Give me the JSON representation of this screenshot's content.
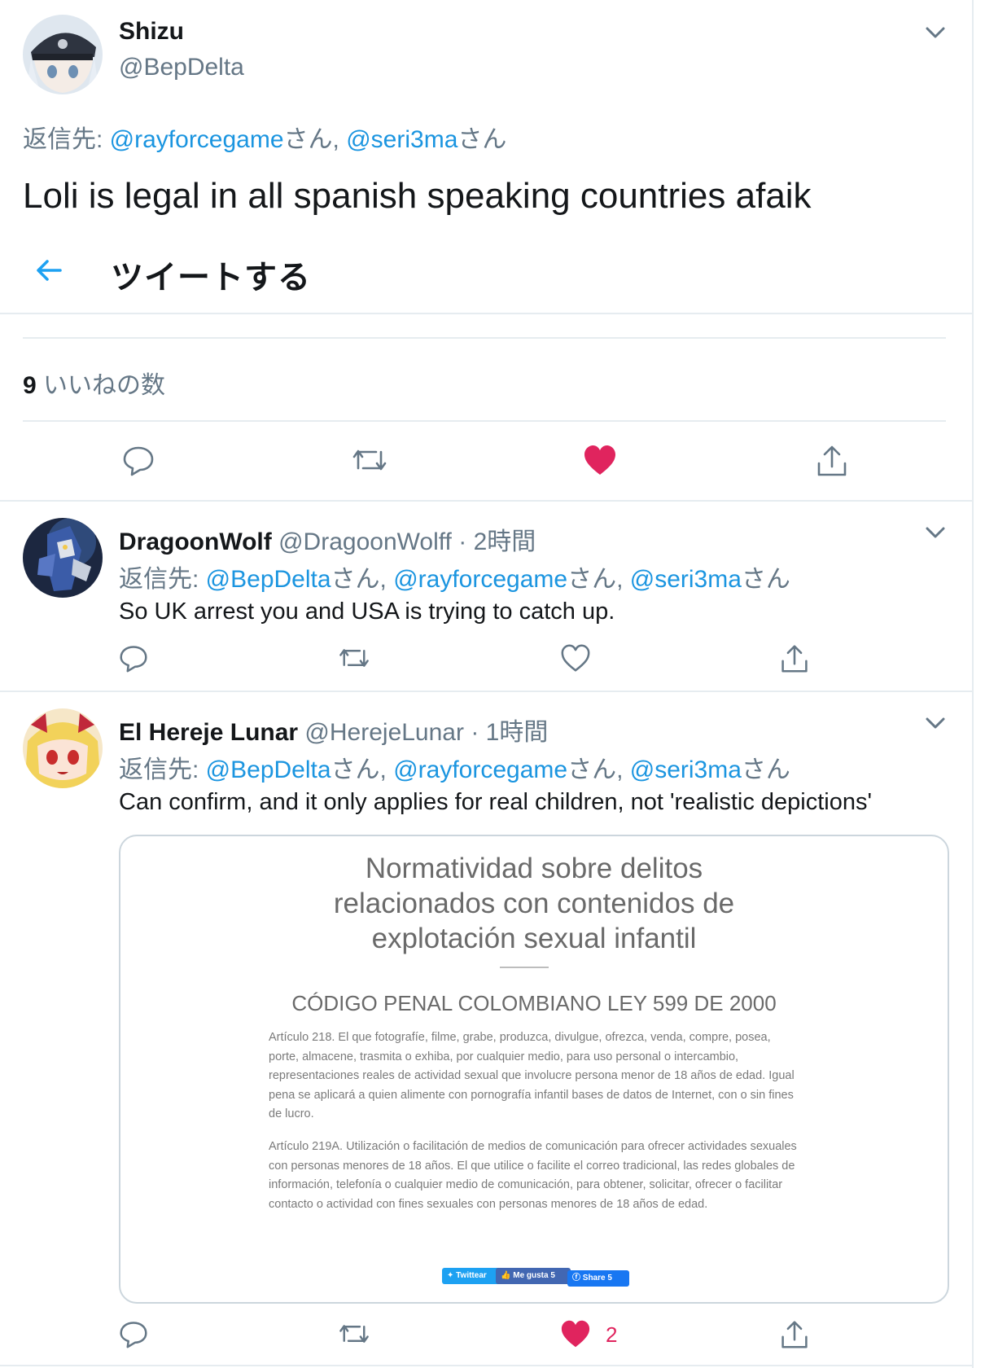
{
  "main_tweet": {
    "name": "Shizu",
    "handle": "@BepDelta",
    "reply_prefix": "返信先: ",
    "reply_to": [
      "@rayforcegame",
      "@seri3ma"
    ],
    "reply_suffix": "さん",
    "reply_sep": ", ",
    "text": "Loli is legal in all spanish speaking countries afaik",
    "likes_count": "9",
    "likes_label": " いいねの数",
    "liked": true
  },
  "header": {
    "back_icon": "back-arrow-icon",
    "title": "ツイートする"
  },
  "replies": [
    {
      "name": "DragoonWolf",
      "handle": "@DragoonWolff",
      "time": "2時間",
      "reply_prefix": "返信先: ",
      "reply_to": [
        "@BepDelta",
        "@rayforcegame",
        "@seri3ma"
      ],
      "text": "So UK arrest you and USA is trying to catch up.",
      "liked": false,
      "like_count": ""
    },
    {
      "name": "El Hereje Lunar",
      "handle": "@HerejeLunar",
      "time": "1時間",
      "reply_prefix": "返信先: ",
      "reply_to": [
        "@BepDelta",
        "@rayforcegame",
        "@seri3ma"
      ],
      "text": "Can confirm, and it only applies for real children, not 'realistic depictions'",
      "liked": true,
      "like_count": "2"
    }
  ],
  "card": {
    "title_lines": [
      "Normatividad sobre delitos",
      "relacionados con contenidos de",
      "explotación sexual infantil"
    ],
    "subtitle": "CÓDIGO PENAL COLOMBIANO LEY 599 DE 2000",
    "para1": "Artículo 218. El que fotografíe, filme, grabe, produzca, divulgue, ofrezca, venda, compre, posea, porte, almacene, trasmita o exhiba, por cualquier medio, para uso personal o intercambio, representaciones reales de actividad sexual que involucre persona menor de 18 años de edad. Igual pena se aplicará a quien alimente con pornografía infantil bases de datos de Internet, con o sin fines de lucro.",
    "para2": "Artículo 219A. Utilización o facilitación de medios de comunicación para ofrecer actividades sexuales con personas menores de 18 años. El que utilice o facilite el correo tradicional, las redes globales de información, telefonía o cualquier medio de comunicación, para obtener, solicitar, ofrecer o facilitar contacto o actividad con fines sexuales con personas menores de 18 años de edad.",
    "share_twitter": "Twittear",
    "share_like": "Me gusta 5",
    "share_facebook": "Share 5"
  },
  "colors": {
    "link": "#1b95e0",
    "muted": "#657786",
    "like_red": "#e0245e",
    "border": "#e6ecf0"
  }
}
